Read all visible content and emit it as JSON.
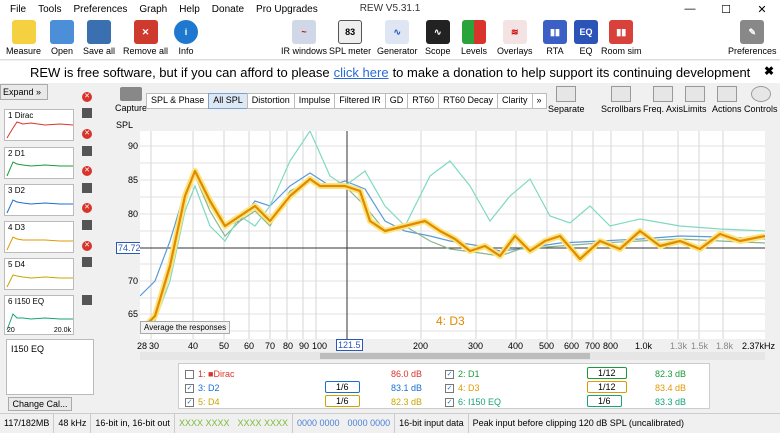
{
  "app": {
    "title": "REW V5.31.1"
  },
  "menu": [
    "File",
    "Tools",
    "Preferences",
    "Graph",
    "Help",
    "Donate",
    "Pro Upgrades"
  ],
  "toolbar": {
    "left": [
      {
        "label": "Measure",
        "icon": "measure-icon"
      },
      {
        "label": "Open",
        "icon": "folder-icon"
      },
      {
        "label": "Save all",
        "icon": "save-icon"
      },
      {
        "label": "Remove all",
        "icon": "remove-icon"
      },
      {
        "label": "Info",
        "icon": "info-icon"
      }
    ],
    "right": [
      {
        "label": "IR windows"
      },
      {
        "label": "SPL meter",
        "badge": "83"
      },
      {
        "label": "Generator"
      },
      {
        "label": "Scope"
      },
      {
        "label": "Levels"
      },
      {
        "label": "Overlays"
      },
      {
        "label": "RTA"
      },
      {
        "label": "EQ"
      },
      {
        "label": "Room sim"
      }
    ],
    "preferences": "Preferences"
  },
  "banner": {
    "text1": "REW is free software, but if you can afford to please",
    "link": "click here",
    "text2": "to make a donation to help support its continuing development",
    "close": "✖"
  },
  "sidebar": {
    "expand": "Expand",
    "measurements": [
      {
        "num": "1",
        "name": "Dirac"
      },
      {
        "num": "2",
        "name": "D1"
      },
      {
        "num": "3",
        "name": "D2"
      },
      {
        "num": "4",
        "name": "D3"
      },
      {
        "num": "5",
        "name": "D4"
      },
      {
        "num": "6",
        "name": "I150 EQ",
        "range_lo": "20",
        "range_hi": "20.0k"
      }
    ],
    "notes": "I150 EQ",
    "change_cal": "Change Cal..."
  },
  "capture": "Capture",
  "tabs": [
    "SPL & Phase",
    "All SPL",
    "Distortion",
    "Impulse",
    "Filtered IR",
    "GD",
    "RT60",
    "RT60 Decay",
    "Clarity",
    "»"
  ],
  "right_tools": [
    "Separate",
    "Scrollbars",
    "Freq. Axis",
    "Limits",
    "Actions",
    "Controls"
  ],
  "graph": {
    "ylabel": "SPL",
    "yticks": [
      "90",
      "85",
      "80",
      "75",
      "70",
      "65"
    ],
    "cursor_y": "74.72",
    "xticks": [
      "28",
      "30",
      "40",
      "50",
      "60",
      "70",
      "80",
      "90",
      "100",
      "200",
      "300",
      "400",
      "500",
      "600",
      "700",
      "800",
      "1.0k",
      "1.3k",
      "1.5k",
      "1.8k",
      "2.37kHz"
    ],
    "cursor_x": "121.5",
    "tooltip": "Average the responses",
    "overlay_label": "4: D3"
  },
  "legend": [
    {
      "label": "1: ■Dirac",
      "value": "86.0 dB",
      "checked": false,
      "color": "#d9342b",
      "frac": ""
    },
    {
      "label": "2: D1",
      "value": "82.3 dB",
      "checked": true,
      "color": "#1a9b3a",
      "frac": "1/12"
    },
    {
      "label": "3: D2",
      "value": "83.1 dB",
      "checked": true,
      "color": "#1a6fd0",
      "frac": "1/6"
    },
    {
      "label": "4: D3",
      "value": "83.4 dB",
      "checked": true,
      "color": "#e09a00",
      "frac": "1/12"
    },
    {
      "label": "5: D4",
      "value": "82.3 dB",
      "checked": true,
      "color": "#c9a600",
      "frac": "1/6"
    },
    {
      "label": "6: I150 EQ",
      "value": "83.3 dB",
      "checked": true,
      "color": "#16a37a",
      "frac": "1/6"
    }
  ],
  "status": {
    "memory": "117/182MB",
    "rate": "48 kHz",
    "bits": "16-bit in, 16-bit out",
    "levels1": "XXXX XXXX",
    "levels2": "XXXX XXXX",
    "levels3": "0000 0000",
    "levels4": "0000 0000",
    "input": "16-bit input data",
    "peak": "Peak input before clipping 120 dB SPL (uncalibrated)"
  }
}
